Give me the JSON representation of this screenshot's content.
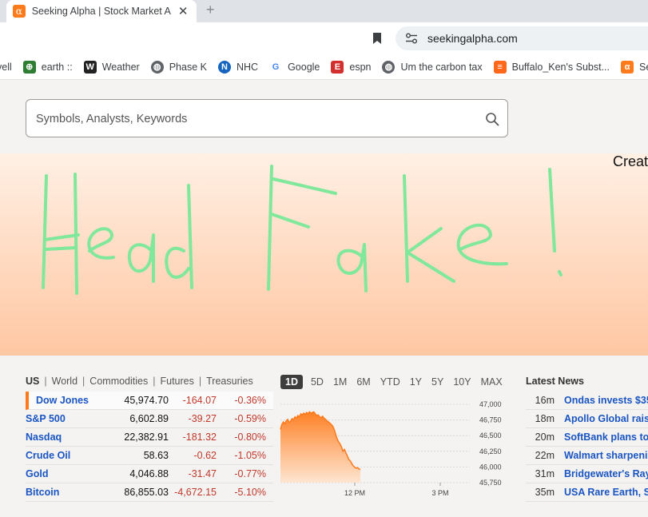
{
  "browser": {
    "tab_title": "Seeking Alpha | Stock Market Analysis",
    "tab_icon": "α",
    "new_tab": "+",
    "close": "✕",
    "url": "seekingalpha.com"
  },
  "bookmarks": [
    {
      "label": "vell",
      "icon": "",
      "color": ""
    },
    {
      "label": "earth ::",
      "icon": "earth-icon",
      "color": "#2e7d32"
    },
    {
      "label": "Weather",
      "icon": "wu-icon",
      "color": "#222222"
    },
    {
      "label": "Phase K",
      "icon": "globe-icon",
      "color": "#5f6368"
    },
    {
      "label": "NHC",
      "icon": "noaa-icon",
      "color": "#1565c0"
    },
    {
      "label": "Google",
      "icon": "google-icon",
      "color": "#ffffff"
    },
    {
      "label": "espn",
      "icon": "espn-icon",
      "color": "#d32f2f"
    },
    {
      "label": "Um the carbon tax",
      "icon": "globe-icon",
      "color": "#5f6368"
    },
    {
      "label": "Buffalo_Ken's Subst...",
      "icon": "substack-icon",
      "color": "#ff6719"
    },
    {
      "label": "Seek",
      "icon": "seeking-alpha-icon",
      "color": "#ff7a1a"
    }
  ],
  "search": {
    "placeholder": "Symbols, Analysts, Keywords"
  },
  "banner": {
    "cta_partial": "Creat",
    "drawing_color": "#7fe89a"
  },
  "markets": {
    "regions": [
      "US",
      "World",
      "Commodities",
      "Futures",
      "Treasuries"
    ],
    "separator": "|",
    "quotes": [
      {
        "name": "Dow Jones",
        "price": "45,974.70",
        "change": "-164.07",
        "pct": "-0.36%"
      },
      {
        "name": "S&P 500",
        "price": "6,602.89",
        "change": "-39.27",
        "pct": "-0.59%"
      },
      {
        "name": "Nasdaq",
        "price": "22,382.91",
        "change": "-181.32",
        "pct": "-0.80%"
      },
      {
        "name": "Crude Oil",
        "price": "58.63",
        "change": "-0.62",
        "pct": "-1.05%"
      },
      {
        "name": "Gold",
        "price": "4,046.88",
        "change": "-31.47",
        "pct": "-0.77%"
      },
      {
        "name": "Bitcoin",
        "price": "86,855.03",
        "change": "-4,672.15",
        "pct": "-5.10%"
      }
    ],
    "ranges": [
      "1D",
      "5D",
      "1M",
      "6M",
      "YTD",
      "1Y",
      "5Y",
      "10Y",
      "MAX"
    ],
    "active_range": "1D",
    "down_color": "#c0392b",
    "link_color": "#1a55c2"
  },
  "chart_data": {
    "type": "area",
    "y_ticks": [
      "47,000",
      "46,750",
      "46,500",
      "46,250",
      "46,000",
      "45,750"
    ],
    "ylim": [
      45750,
      47000
    ],
    "x_ticks": [
      "12 PM",
      "3 PM"
    ],
    "series": [
      {
        "values": [
          46600,
          46680,
          46720,
          46690,
          46740,
          46760,
          46710,
          46730,
          46770,
          46760,
          46800,
          46780,
          46820,
          46800,
          46850,
          46830,
          46860,
          46840,
          46870,
          46850,
          46880,
          46860,
          46870,
          46880,
          46850,
          46820,
          46830,
          46800,
          46790,
          46810,
          46780,
          46760,
          46740,
          46720,
          46700,
          46680,
          46650,
          46600,
          46520,
          46450,
          46400,
          46370,
          46320,
          46250,
          46280,
          46230,
          46180,
          46120,
          46100,
          46060,
          46020,
          46000,
          45980,
          45990,
          45970,
          45960
        ]
      }
    ],
    "color": "#ff7a1a"
  },
  "news": {
    "title": "Latest News",
    "items": [
      {
        "time": "16m",
        "headline": "Ondas invests $35"
      },
      {
        "time": "18m",
        "headline": "Apollo Global raise"
      },
      {
        "time": "20m",
        "headline": "SoftBank plans to"
      },
      {
        "time": "22m",
        "headline": "Walmart sharpenin"
      },
      {
        "time": "31m",
        "headline": "Bridgewater's Ray"
      },
      {
        "time": "35m",
        "headline": "USA Rare Earth, Se"
      }
    ]
  }
}
